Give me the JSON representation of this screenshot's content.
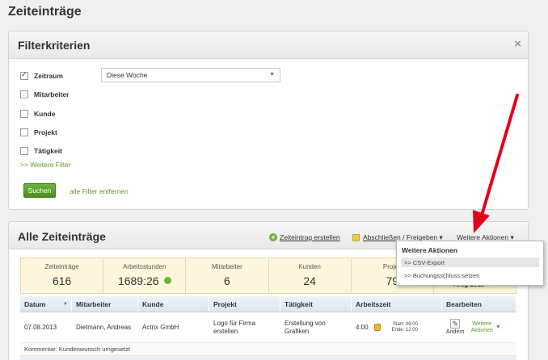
{
  "page_title": "Zeiteinträge",
  "filter": {
    "title": "Filterkriterien",
    "close": "×",
    "rows": [
      {
        "label": "Zeitraum",
        "checked": true
      },
      {
        "label": "Mitarbeiter",
        "checked": false
      },
      {
        "label": "Kunde",
        "checked": false
      },
      {
        "label": "Projekt",
        "checked": false
      },
      {
        "label": "Tätigkeit",
        "checked": false
      }
    ],
    "zeitraum_value": "Diese Woche",
    "more_filters": ">> Weitere Filter",
    "search_label": "Suchen",
    "remove_all": "alle Filter entfernen"
  },
  "list": {
    "title": "Alle Zeiteinträge",
    "create_label": "Zeiteintrag erstellen",
    "lock_label": "Abschließen / Freigeben ▾",
    "more_actions_label": "Weitere Aktionen ▾",
    "stats": [
      {
        "label": "Zeiteinträge",
        "value": "616"
      },
      {
        "label": "Arbeitsstunden",
        "value": "1689:26"
      },
      {
        "label": "Mitarbeiter",
        "value": "6"
      },
      {
        "label": "Kunden",
        "value": "24"
      },
      {
        "label": "Projek",
        "value": "79"
      }
    ],
    "columns": [
      "Datum",
      "Mitarbeiter",
      "Kunde",
      "Projekt",
      "Tätigkeit",
      "Arbeitszeit",
      "Bearbeiten"
    ],
    "row": {
      "datum": "07.08.2013",
      "mitarbeiter": "Dietmann, Andreas",
      "kunde": "Actrix GmbH",
      "projekt_1": "Logo für Firma",
      "projekt_2": "erstellen",
      "taetigkeit_1": "Erstellung von",
      "taetigkeit_2": "Grafiken",
      "arbeitszeit": "4:00",
      "start": "Start: 08:00",
      "ende": "Ende: 12:00",
      "aendern": "Ändern",
      "weitere_1": "Weitere",
      "weitere_2": "Aktionen"
    },
    "comment": "Kommentar: Kundenwunsch umgesetzt"
  },
  "dropdown": {
    "title": "Weitere Aktionen",
    "items": [
      ">> CSV-Export",
      ">> Buchungsschluss setzen"
    ]
  },
  "behind_text": "rtrag 2013",
  "colors": {
    "accent_green": "#6cb33e",
    "arrow_red": "#e3001b"
  }
}
